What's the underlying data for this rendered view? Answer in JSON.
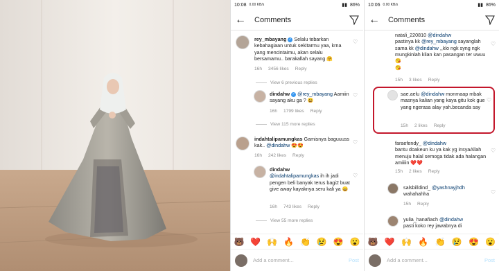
{
  "panel1": {
    "status": {
      "time": "10:08",
      "net": "0.00 KB/s",
      "battery": "86%"
    },
    "title": "Comments",
    "comments": [
      {
        "user": "rey_mbayang",
        "text": "Selalu tebarkan kebahagiaan untuk sekitarmu yaa, krna yang mencintaimu, akan selalu bersamamu.. barakallah sayang",
        "emoji": "🤗",
        "time": "16h",
        "likes": "3456 likes",
        "reply": "Reply"
      },
      {
        "view_replies": "View 6 previous replies"
      },
      {
        "user": "dindahw",
        "mention": "@rey_mbayang",
        "text": "Aamiin sayang aku ga ?",
        "emoji": "😀",
        "time": "16h",
        "likes": "1799 likes",
        "reply": "Reply"
      },
      {
        "view_replies": "View 115 more replies"
      },
      {
        "user": "indahtalipamungkas",
        "text": "Gamisnya baguuuss kak..",
        "mention": "@dindahw",
        "emoji": "😍😍",
        "time": "16h",
        "likes": "242 likes",
        "reply": "Reply"
      },
      {
        "user": "dindahw",
        "mention": "@indahtalipamungkas",
        "text": "ih ih jadi pengen beli banyak terus bagi2 buat give away kayaknya seru kali ya",
        "emoji": "😄",
        "time": "16h",
        "likes": "743 likes",
        "reply": "Reply"
      },
      {
        "view_replies": "View 55 more replies"
      }
    ],
    "emojis": [
      "🐻",
      "❤️",
      "🙌",
      "🔥",
      "👏",
      "😢",
      "😍",
      "😮"
    ],
    "add_comment": "Add a comment...",
    "post": "Post"
  },
  "panel2": {
    "status": {
      "time": "10:06",
      "net": "0.00 KB/s",
      "battery": "86%"
    },
    "title": "Comments",
    "comments": [
      {
        "user": "natali_220810",
        "mention": "@dindahw",
        "text1": "pastinya kk",
        "mention2": "@rey_mbayang",
        "text2": "sayanglah sama kk",
        "mention3": "@dindahw",
        "text3": ",,klo ngk syng ngk mungkinlah klian kan pasangan ter uwuu",
        "emoji": "😘",
        "emoji2": "😘",
        "time": "15h",
        "likes": "3 likes",
        "reply": "Reply"
      },
      {
        "user": "sae.aelu",
        "mention": "@dindahw",
        "text": "monmaap mbak masnya kalian yang kaya gitu kok gue yang ngerasa alay yah.becanda say",
        "time": "15h",
        "likes": "2 likes",
        "reply": "Reply"
      },
      {
        "user": "faraefendy_",
        "mention": "@dindahw",
        "text": "bantu doakeun ku ya kak yg insyaAllah menuju halal semoga tidak ada halangan amiiiin",
        "emoji": "❤️❤️",
        "time": "15h",
        "likes": "2 likes",
        "reply": "Reply"
      },
      {
        "user": "salsbilldind_",
        "mention": "@yashnayjhdh",
        "text": "wahahahha",
        "time": "15h",
        "reply": "Reply"
      },
      {
        "user": "yulia_hanafiach",
        "mention": "@dindahw",
        "text": "pasti koko rey jawabnya di"
      }
    ],
    "emojis": [
      "🐻",
      "❤️",
      "🙌",
      "🔥",
      "👏",
      "😢",
      "😍",
      "😮"
    ],
    "add_comment": "Add a comment...",
    "post": "Post"
  }
}
